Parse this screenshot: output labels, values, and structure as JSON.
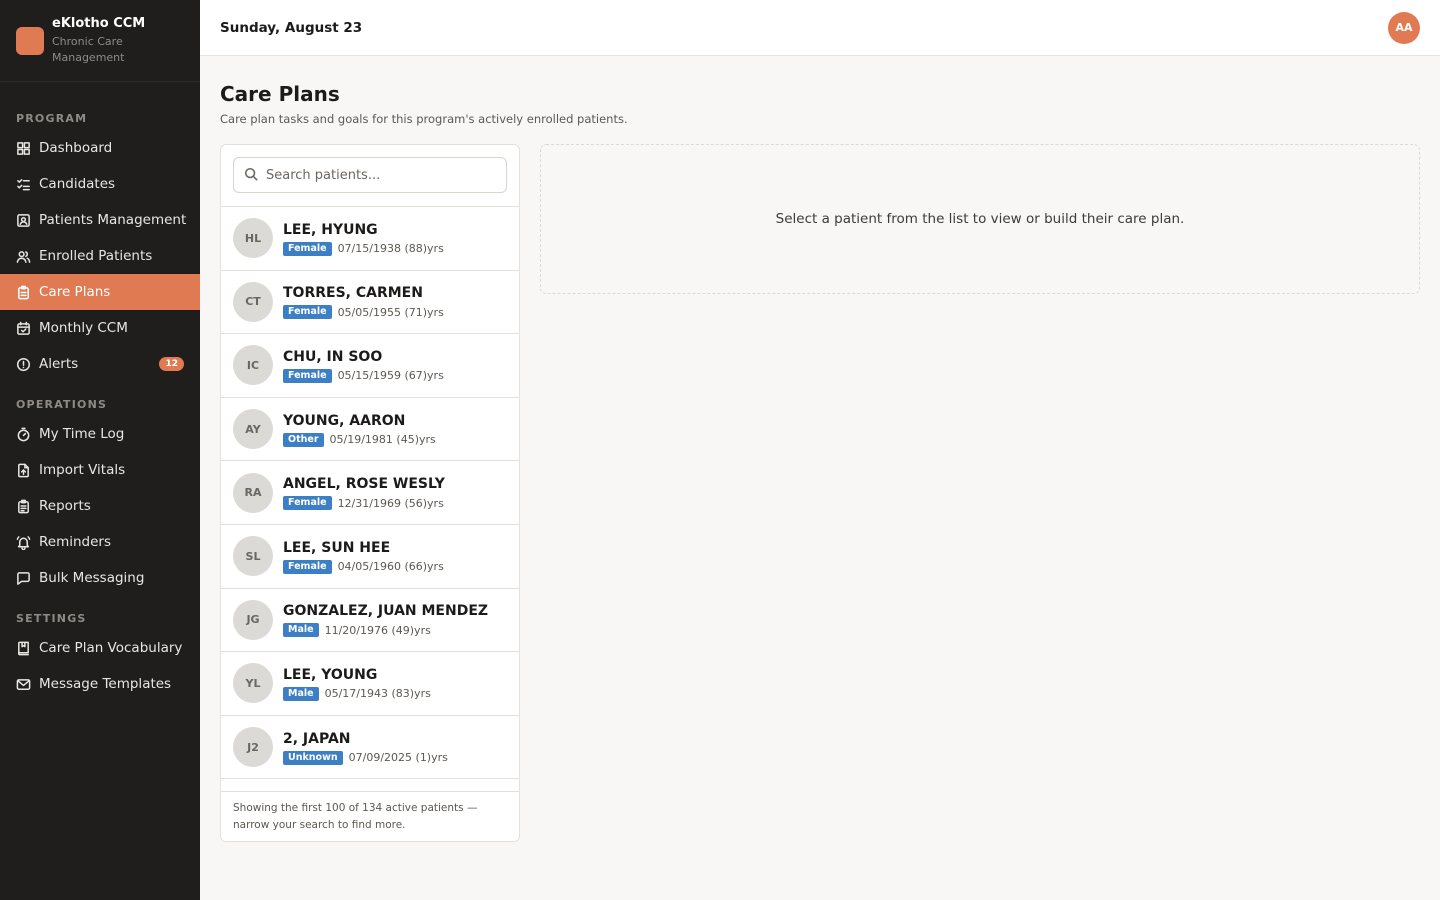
{
  "brand": {
    "name": "eKlotho CCM",
    "subtitle": "Chronic Care Management"
  },
  "sidebar": {
    "sections": [
      {
        "title": "PROGRAM",
        "items": [
          {
            "label": "Dashboard",
            "icon": "dashboard-icon"
          },
          {
            "label": "Candidates",
            "icon": "checklist-icon"
          },
          {
            "label": "Patients Management",
            "icon": "contact-card-icon"
          },
          {
            "label": "Enrolled Patients",
            "icon": "users-icon"
          },
          {
            "label": "Care Plans",
            "icon": "clipboard-icon",
            "active": true
          },
          {
            "label": "Monthly CCM",
            "icon": "calendar-icon"
          },
          {
            "label": "Alerts",
            "icon": "alert-circle-icon",
            "badge": "12"
          }
        ]
      },
      {
        "title": "OPERATIONS",
        "items": [
          {
            "label": "My Time Log",
            "icon": "stopwatch-icon"
          },
          {
            "label": "Import Vitals",
            "icon": "file-upload-icon"
          },
          {
            "label": "Reports",
            "icon": "report-icon"
          },
          {
            "label": "Reminders",
            "icon": "bell-icon"
          },
          {
            "label": "Bulk Messaging",
            "icon": "message-icon"
          }
        ]
      },
      {
        "title": "SETTINGS",
        "items": [
          {
            "label": "Care Plan Vocabulary",
            "icon": "book-icon"
          },
          {
            "label": "Message Templates",
            "icon": "mail-icon"
          }
        ]
      }
    ]
  },
  "header": {
    "date": "Sunday, August 23",
    "avatar_initials": "AA"
  },
  "main": {
    "title": "Care Plans",
    "subtitle": "Care plan tasks and goals for this program's actively enrolled patients.",
    "search": {
      "placeholder": "Search patients...",
      "value": ""
    },
    "patients": [
      {
        "initials": "HL",
        "name": "LEE, HYUNG",
        "gender": "Female",
        "dob": "07/15/1938 (88)yrs"
      },
      {
        "initials": "CT",
        "name": "TORRES, CARMEN",
        "gender": "Female",
        "dob": "05/05/1955 (71)yrs"
      },
      {
        "initials": "IC",
        "name": "CHU, IN SOO",
        "gender": "Female",
        "dob": "05/15/1959 (67)yrs"
      },
      {
        "initials": "AY",
        "name": "YOUNG, AARON",
        "gender": "Other",
        "dob": "05/19/1981 (45)yrs"
      },
      {
        "initials": "RA",
        "name": "ANGEL, ROSE WESLY",
        "gender": "Female",
        "dob": "12/31/1969 (56)yrs"
      },
      {
        "initials": "SL",
        "name": "LEE, SUN HEE",
        "gender": "Female",
        "dob": "04/05/1960 (66)yrs"
      },
      {
        "initials": "JG",
        "name": "GONZALEZ, JUAN MENDEZ",
        "gender": "Male",
        "dob": "11/20/1976 (49)yrs"
      },
      {
        "initials": "YL",
        "name": "LEE, YOUNG",
        "gender": "Male",
        "dob": "05/17/1943 (83)yrs"
      },
      {
        "initials": "J2",
        "name": "2, JAPAN",
        "gender": "Unknown",
        "dob": "07/09/2025 (1)yrs"
      }
    ],
    "list_footer": "Showing the first 100 of 134 active patients — narrow your search to find more.",
    "empty_state": "Select a patient from the list to view or build their care plan."
  },
  "colors": {
    "accent": "#e07a53",
    "sidebar_bg": "#1f1e1d",
    "gender_badge": "#3d7fc4"
  }
}
